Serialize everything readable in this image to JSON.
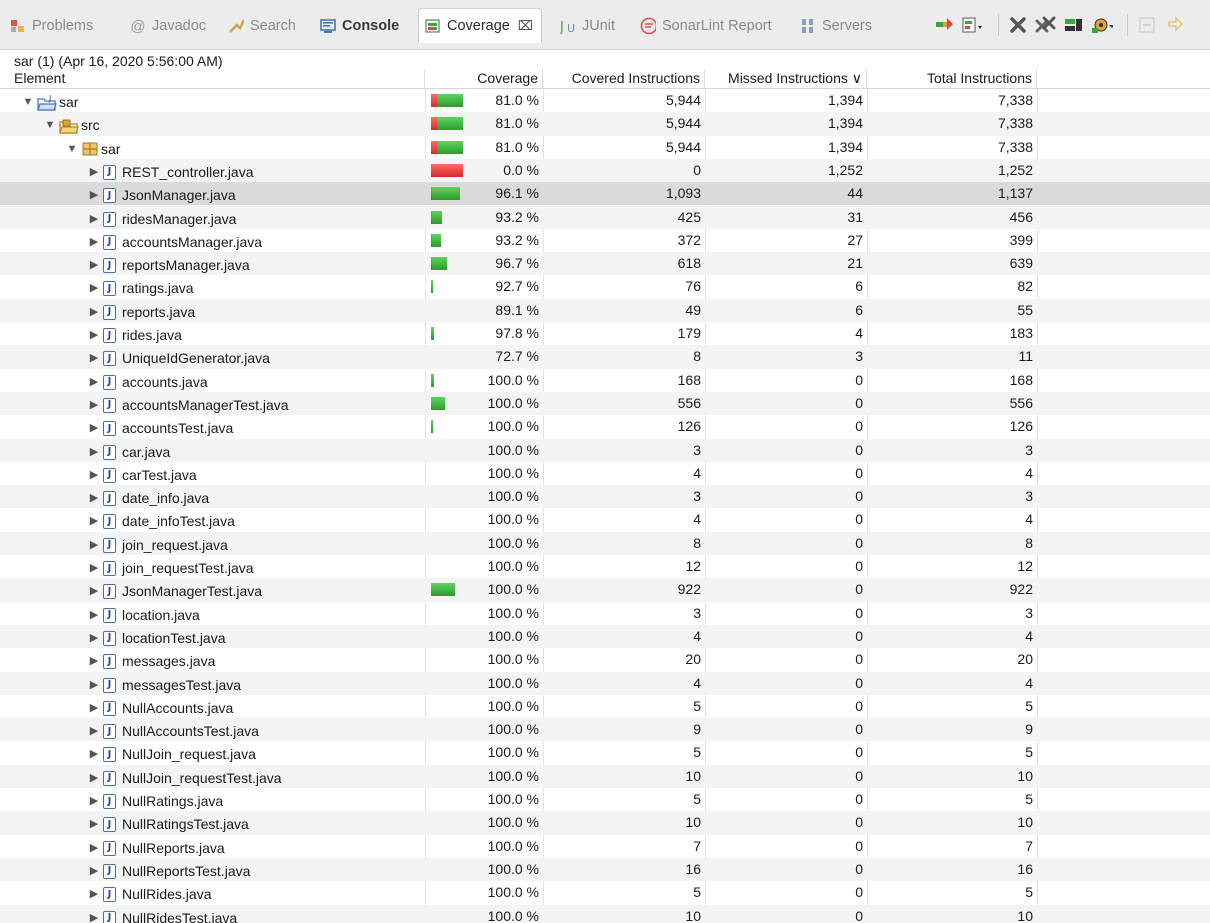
{
  "tabs": [
    {
      "label": "Problems",
      "icon": "problems-icon"
    },
    {
      "label": "Javadoc",
      "icon": "at-icon"
    },
    {
      "label": "Search",
      "icon": "search-icon"
    },
    {
      "label": "Console",
      "icon": "console-icon"
    },
    {
      "label": "Coverage",
      "icon": "coverage-icon",
      "active": true
    },
    {
      "label": "JUnit",
      "icon": "junit-icon"
    },
    {
      "label": "SonarLint Report",
      "icon": "sonarlint-icon"
    },
    {
      "label": "Servers",
      "icon": "servers-icon"
    }
  ],
  "session": "sar (1) (Apr 16, 2020 5:56:00 AM)",
  "columns": {
    "element": "Element",
    "coverage": "Coverage",
    "covered": "Covered Instructions",
    "missed": "Missed Instructions ∨",
    "total": "Total Instructions"
  },
  "rows": [
    {
      "name": "sar",
      "level": 0,
      "kind": "project",
      "expanded": true,
      "coverage": "81.0 %",
      "covered": "5,944",
      "missed": "1,394",
      "total": "7,338",
      "cov_frac": 0.81,
      "bar_frac": 1.0
    },
    {
      "name": "src",
      "level": 1,
      "kind": "srcfolder",
      "expanded": true,
      "coverage": "81.0 %",
      "covered": "5,944",
      "missed": "1,394",
      "total": "7,338",
      "cov_frac": 0.81,
      "bar_frac": 1.0
    },
    {
      "name": "sar",
      "level": 2,
      "kind": "package",
      "expanded": true,
      "coverage": "81.0 %",
      "covered": "5,944",
      "missed": "1,394",
      "total": "7,338",
      "cov_frac": 0.81,
      "bar_frac": 1.0
    },
    {
      "name": "REST_controller.java",
      "level": 3,
      "kind": "java",
      "coverage": "0.0 %",
      "covered": "0",
      "missed": "1,252",
      "total": "1,252",
      "cov_frac": 0.0,
      "bar_frac": 1.0
    },
    {
      "name": "JsonManager.java",
      "level": 3,
      "kind": "java",
      "coverage": "96.1 %",
      "covered": "1,093",
      "missed": "44",
      "total": "1,137",
      "cov_frac": 0.961,
      "bar_frac": 0.91,
      "selected": true
    },
    {
      "name": "ridesManager.java",
      "level": 3,
      "kind": "java",
      "coverage": "93.2 %",
      "covered": "425",
      "missed": "31",
      "total": "456",
      "cov_frac": 0.932,
      "bar_frac": 0.33
    },
    {
      "name": "accountsManager.java",
      "level": 3,
      "kind": "java",
      "coverage": "93.2 %",
      "covered": "372",
      "missed": "27",
      "total": "399",
      "cov_frac": 0.932,
      "bar_frac": 0.3
    },
    {
      "name": "reportsManager.java",
      "level": 3,
      "kind": "java",
      "coverage": "96.7 %",
      "covered": "618",
      "missed": "21",
      "total": "639",
      "cov_frac": 0.967,
      "bar_frac": 0.5
    },
    {
      "name": "ratings.java",
      "level": 3,
      "kind": "java",
      "coverage": "92.7 %",
      "covered": "76",
      "missed": "6",
      "total": "82",
      "cov_frac": 0.927,
      "bar_frac": 0.04
    },
    {
      "name": "reports.java",
      "level": 3,
      "kind": "java",
      "coverage": "89.1 %",
      "covered": "49",
      "missed": "6",
      "total": "55",
      "cov_frac": 0.891,
      "bar_frac": 0.0
    },
    {
      "name": "rides.java",
      "level": 3,
      "kind": "java",
      "coverage": "97.8 %",
      "covered": "179",
      "missed": "4",
      "total": "183",
      "cov_frac": 0.978,
      "bar_frac": 0.1
    },
    {
      "name": "UniqueIdGenerator.java",
      "level": 3,
      "kind": "java",
      "coverage": "72.7 %",
      "covered": "8",
      "missed": "3",
      "total": "11",
      "cov_frac": 0.727,
      "bar_frac": 0.0
    },
    {
      "name": "accounts.java",
      "level": 3,
      "kind": "java",
      "coverage": "100.0 %",
      "covered": "168",
      "missed": "0",
      "total": "168",
      "cov_frac": 1.0,
      "bar_frac": 0.1
    },
    {
      "name": "accountsManagerTest.java",
      "level": 3,
      "kind": "java",
      "coverage": "100.0 %",
      "covered": "556",
      "missed": "0",
      "total": "556",
      "cov_frac": 1.0,
      "bar_frac": 0.45
    },
    {
      "name": "accountsTest.java",
      "level": 3,
      "kind": "java",
      "coverage": "100.0 %",
      "covered": "126",
      "missed": "0",
      "total": "126",
      "cov_frac": 1.0,
      "bar_frac": 0.05
    },
    {
      "name": "car.java",
      "level": 3,
      "kind": "java",
      "coverage": "100.0 %",
      "covered": "3",
      "missed": "0",
      "total": "3",
      "cov_frac": 1.0,
      "bar_frac": 0.0
    },
    {
      "name": "carTest.java",
      "level": 3,
      "kind": "java",
      "coverage": "100.0 %",
      "covered": "4",
      "missed": "0",
      "total": "4",
      "cov_frac": 1.0,
      "bar_frac": 0.0
    },
    {
      "name": "date_info.java",
      "level": 3,
      "kind": "java",
      "coverage": "100.0 %",
      "covered": "3",
      "missed": "0",
      "total": "3",
      "cov_frac": 1.0,
      "bar_frac": 0.0
    },
    {
      "name": "date_infoTest.java",
      "level": 3,
      "kind": "java",
      "coverage": "100.0 %",
      "covered": "4",
      "missed": "0",
      "total": "4",
      "cov_frac": 1.0,
      "bar_frac": 0.0
    },
    {
      "name": "join_request.java",
      "level": 3,
      "kind": "java",
      "coverage": "100.0 %",
      "covered": "8",
      "missed": "0",
      "total": "8",
      "cov_frac": 1.0,
      "bar_frac": 0.0
    },
    {
      "name": "join_requestTest.java",
      "level": 3,
      "kind": "java",
      "coverage": "100.0 %",
      "covered": "12",
      "missed": "0",
      "total": "12",
      "cov_frac": 1.0,
      "bar_frac": 0.0
    },
    {
      "name": "JsonManagerTest.java",
      "level": 3,
      "kind": "java",
      "coverage": "100.0 %",
      "covered": "922",
      "missed": "0",
      "total": "922",
      "cov_frac": 1.0,
      "bar_frac": 0.76
    },
    {
      "name": "location.java",
      "level": 3,
      "kind": "java",
      "coverage": "100.0 %",
      "covered": "3",
      "missed": "0",
      "total": "3",
      "cov_frac": 1.0,
      "bar_frac": 0.0
    },
    {
      "name": "locationTest.java",
      "level": 3,
      "kind": "java",
      "coverage": "100.0 %",
      "covered": "4",
      "missed": "0",
      "total": "4",
      "cov_frac": 1.0,
      "bar_frac": 0.0
    },
    {
      "name": "messages.java",
      "level": 3,
      "kind": "java",
      "coverage": "100.0 %",
      "covered": "20",
      "missed": "0",
      "total": "20",
      "cov_frac": 1.0,
      "bar_frac": 0.0
    },
    {
      "name": "messagesTest.java",
      "level": 3,
      "kind": "java",
      "coverage": "100.0 %",
      "covered": "4",
      "missed": "0",
      "total": "4",
      "cov_frac": 1.0,
      "bar_frac": 0.0
    },
    {
      "name": "NullAccounts.java",
      "level": 3,
      "kind": "java",
      "coverage": "100.0 %",
      "covered": "5",
      "missed": "0",
      "total": "5",
      "cov_frac": 1.0,
      "bar_frac": 0.0
    },
    {
      "name": "NullAccountsTest.java",
      "level": 3,
      "kind": "java",
      "coverage": "100.0 %",
      "covered": "9",
      "missed": "0",
      "total": "9",
      "cov_frac": 1.0,
      "bar_frac": 0.0
    },
    {
      "name": "NullJoin_request.java",
      "level": 3,
      "kind": "java",
      "coverage": "100.0 %",
      "covered": "5",
      "missed": "0",
      "total": "5",
      "cov_frac": 1.0,
      "bar_frac": 0.0
    },
    {
      "name": "NullJoin_requestTest.java",
      "level": 3,
      "kind": "java",
      "coverage": "100.0 %",
      "covered": "10",
      "missed": "0",
      "total": "10",
      "cov_frac": 1.0,
      "bar_frac": 0.0
    },
    {
      "name": "NullRatings.java",
      "level": 3,
      "kind": "java",
      "coverage": "100.0 %",
      "covered": "5",
      "missed": "0",
      "total": "5",
      "cov_frac": 1.0,
      "bar_frac": 0.0
    },
    {
      "name": "NullRatingsTest.java",
      "level": 3,
      "kind": "java",
      "coverage": "100.0 %",
      "covered": "10",
      "missed": "0",
      "total": "10",
      "cov_frac": 1.0,
      "bar_frac": 0.0
    },
    {
      "name": "NullReports.java",
      "level": 3,
      "kind": "java",
      "coverage": "100.0 %",
      "covered": "7",
      "missed": "0",
      "total": "7",
      "cov_frac": 1.0,
      "bar_frac": 0.0
    },
    {
      "name": "NullReportsTest.java",
      "level": 3,
      "kind": "java",
      "coverage": "100.0 %",
      "covered": "16",
      "missed": "0",
      "total": "16",
      "cov_frac": 1.0,
      "bar_frac": 0.0
    },
    {
      "name": "NullRides.java",
      "level": 3,
      "kind": "java",
      "coverage": "100.0 %",
      "covered": "5",
      "missed": "0",
      "total": "5",
      "cov_frac": 1.0,
      "bar_frac": 0.0
    },
    {
      "name": "NullRidesTest.java",
      "level": 3,
      "kind": "java",
      "coverage": "100.0 %",
      "covered": "10",
      "missed": "0",
      "total": "10",
      "cov_frac": 1.0,
      "bar_frac": 0.0
    }
  ],
  "colors": {
    "covered": "#2c9c2c",
    "missed": "#d42a2a",
    "zebra": "#f4f4f4",
    "selected": "#dadada"
  }
}
